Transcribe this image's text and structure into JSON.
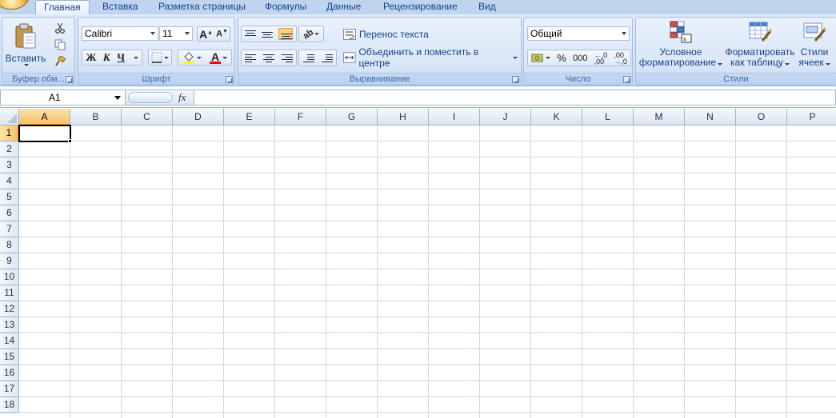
{
  "tabs": [
    {
      "label": "Главная",
      "active": true
    },
    {
      "label": "Вставка"
    },
    {
      "label": "Разметка страницы"
    },
    {
      "label": "Формулы"
    },
    {
      "label": "Данные"
    },
    {
      "label": "Рецензирование"
    },
    {
      "label": "Вид"
    }
  ],
  "clipboard": {
    "paste_label": "Вставить",
    "group_label": "Буфер обм..."
  },
  "font": {
    "family_value": "Calibri",
    "size_value": "11",
    "bold_glyph": "Ж",
    "italic_glyph": "К",
    "underline_glyph": "Ч",
    "grow_glyph": "A",
    "shrink_glyph": "A",
    "color_glyph": "A",
    "group_label": "Шрифт",
    "fill_color": "#ffff00",
    "font_color": "#ff0000"
  },
  "alignment": {
    "wrap_label": "Перенос текста",
    "merge_label": "Объединить и поместить в центре",
    "group_label": "Выравнивание"
  },
  "number": {
    "format_value": "Общий",
    "percent_glyph": "%",
    "thousands_glyph": "000",
    "inc_decimal_glyph": ",0",
    "dec_decimal_glyph": ",00",
    "group_label": "Число"
  },
  "styles": {
    "conditional_line1": "Условное",
    "conditional_line2": "форматирование",
    "table_line1": "Форматировать",
    "table_line2": "как таблицу",
    "cell_styles_line1": "Стили",
    "cell_styles_line2": "ячеек",
    "group_label": "Стили"
  },
  "formula_bar": {
    "name_box": "A1",
    "fx_label": "fx",
    "formula_value": ""
  },
  "sheet": {
    "columns": [
      "A",
      "B",
      "C",
      "D",
      "E",
      "F",
      "G",
      "H",
      "I",
      "J",
      "K",
      "L",
      "M",
      "N",
      "O",
      "P"
    ],
    "rows": [
      "1",
      "2",
      "3",
      "4",
      "5",
      "6",
      "7",
      "8",
      "9",
      "10",
      "11",
      "12",
      "13",
      "14",
      "15",
      "16",
      "17",
      "18"
    ],
    "active_cell": "A1",
    "selection_color": "#f29536"
  }
}
